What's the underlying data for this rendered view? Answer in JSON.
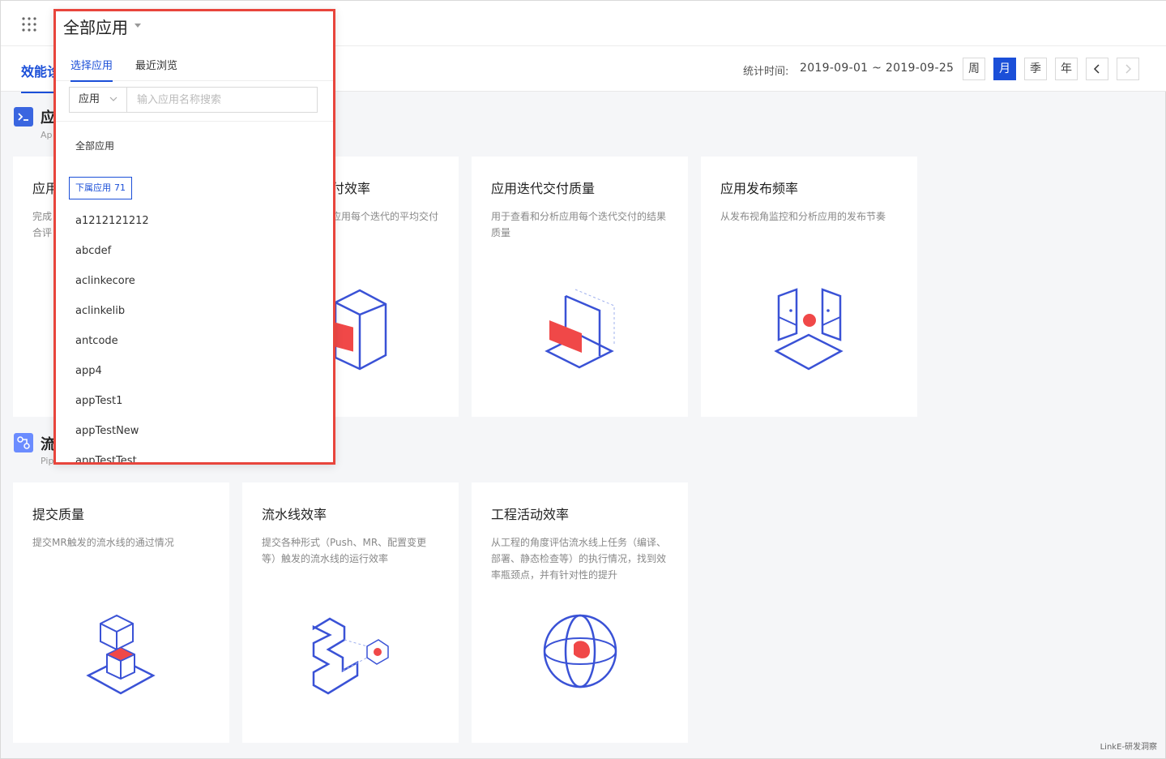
{
  "header": {
    "page_tab": "效能诊断"
  },
  "toolbar": {
    "stat_label": "统计时间:",
    "date_range": "2019-09-01 ~ 2019-09-25",
    "periods": [
      "周",
      "月",
      "季",
      "年"
    ],
    "active_period": "月"
  },
  "sections": {
    "app": {
      "title": "应",
      "sub": "Ap"
    },
    "pipeline": {
      "title": "流",
      "sub": "Pipeline"
    }
  },
  "cards_row1": [
    {
      "title": "应用",
      "desc1": "完成",
      "desc2": "合评"
    },
    {
      "title": "付效率",
      "desc1": "应用每个迭代的平均交付",
      "desc2": ""
    },
    {
      "title": "应用迭代交付质量",
      "desc1": "用于查看和分析应用每个迭代交付的结果",
      "desc2": "质量"
    },
    {
      "title": "应用发布频率",
      "desc1": "从发布视角监控和分析应用的发布节奏",
      "desc2": ""
    }
  ],
  "cards_row2": [
    {
      "title": "提交质量",
      "desc1": "提交MR触发的流水线的通过情况",
      "desc2": "",
      "desc3": ""
    },
    {
      "title": "流水线效率",
      "desc1": "提交各种形式（Push、MR、配置变更",
      "desc2": "等）触发的流水线的运行效率",
      "desc3": ""
    },
    {
      "title": "工程活动效率",
      "desc1": "从工程的角度评估流水线上任务（编译、",
      "desc2": "部署、静态检查等）的执行情况，找到效",
      "desc3": "率瓶颈点，并有针对性的提升"
    }
  ],
  "dropdown": {
    "selected": "全部应用",
    "tabs": [
      "选择应用",
      "最近浏览"
    ],
    "search_type": "应用",
    "search_placeholder": "输入应用名称搜索",
    "all_label": "全部应用",
    "tag_label": "下属应用",
    "tag_count": "71",
    "items": [
      "a1212121212",
      "abcdef",
      "aclinkecore",
      "aclinkelib",
      "antcode",
      "app4",
      "appTest1",
      "appTestNew",
      "appTestTest"
    ]
  },
  "watermark": "LinkE-研发洞察",
  "colors": {
    "primary": "#1b4fd8",
    "accent": "#f04848",
    "highlight_border": "#e8453c"
  }
}
